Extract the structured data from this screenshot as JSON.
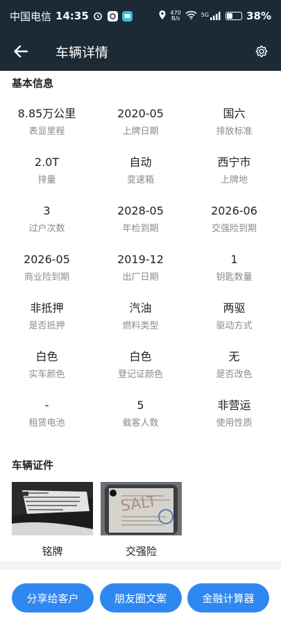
{
  "status_bar": {
    "carrier": "中国电信",
    "time": "14:35",
    "net_speed_value": "470",
    "net_speed_unit": "B/s",
    "network": "5G",
    "battery": "38%",
    "battery_level": 0.38
  },
  "header": {
    "title": "车辆详情",
    "back_icon": "arrow-left-icon",
    "settings_icon": "gear-icon"
  },
  "basic_info": {
    "title": "基本信息",
    "items": [
      {
        "value": "8.85万公里",
        "label": "表显里程"
      },
      {
        "value": "2020-05",
        "label": "上牌日期"
      },
      {
        "value": "国六",
        "label": "排放标准"
      },
      {
        "value": "2.0T",
        "label": "排量"
      },
      {
        "value": "自动",
        "label": "变速箱"
      },
      {
        "value": "西宁市",
        "label": "上牌地"
      },
      {
        "value": "3",
        "label": "过户次数"
      },
      {
        "value": "2028-05",
        "label": "年检到期"
      },
      {
        "value": "2026-06",
        "label": "交强险到期"
      },
      {
        "value": "2026-05",
        "label": "商业险到期"
      },
      {
        "value": "2019-12",
        "label": "出厂日期"
      },
      {
        "value": "1",
        "label": "钥匙数量"
      },
      {
        "value": "非抵押",
        "label": "是否抵押"
      },
      {
        "value": "汽油",
        "label": "燃料类型"
      },
      {
        "value": "两驱",
        "label": "驱动方式"
      },
      {
        "value": "白色",
        "label": "实车颜色"
      },
      {
        "value": "白色",
        "label": "登记证颜色"
      },
      {
        "value": "无",
        "label": "是否改色"
      },
      {
        "value": "-",
        "label": "租赁电池"
      },
      {
        "value": "5",
        "label": "载客人数"
      },
      {
        "value": "非营运",
        "label": "使用性质"
      }
    ]
  },
  "documents": {
    "title": "车辆证件",
    "items": [
      {
        "label": "铭牌",
        "icon": "nameplate-photo"
      },
      {
        "label": "交强险",
        "icon": "insurance-photo"
      }
    ]
  },
  "actions": {
    "share": "分享给客户",
    "moments": "朋友圈文案",
    "finance": "金融计算器"
  },
  "colors": {
    "header_bg": "#1b2a35",
    "accent": "#2f88f0",
    "label": "#8a8a8a"
  }
}
